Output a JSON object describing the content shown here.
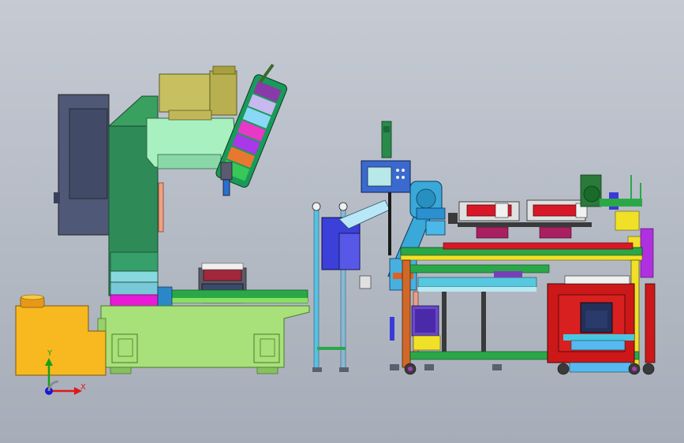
{
  "viewport": {
    "background_top": "#c5cad3",
    "background_bottom": "#a7adb8"
  },
  "triad": {
    "x_label": "X",
    "y_label": "Y",
    "x_color": "#e01818",
    "y_color": "#18a018",
    "origin_color": "#1818d8"
  },
  "colors": {
    "machine_column": "#2e8b57",
    "machine_base": "#a8e07a",
    "spindle_head": "#a8f0c0",
    "motor": "#c8c060",
    "cabinet": "#505a78",
    "coolant_tank": "#f8b820",
    "robot_arm": "#3aa8d8",
    "frame_red": "#cc1818",
    "frame_green": "#2aa848",
    "frame_yellow": "#f0e028",
    "panel": "#3a6ad0"
  },
  "icons": [
    "cnc-machine-icon",
    "robot-arm-icon",
    "control-panel-icon",
    "coordinate-triad-icon"
  ]
}
